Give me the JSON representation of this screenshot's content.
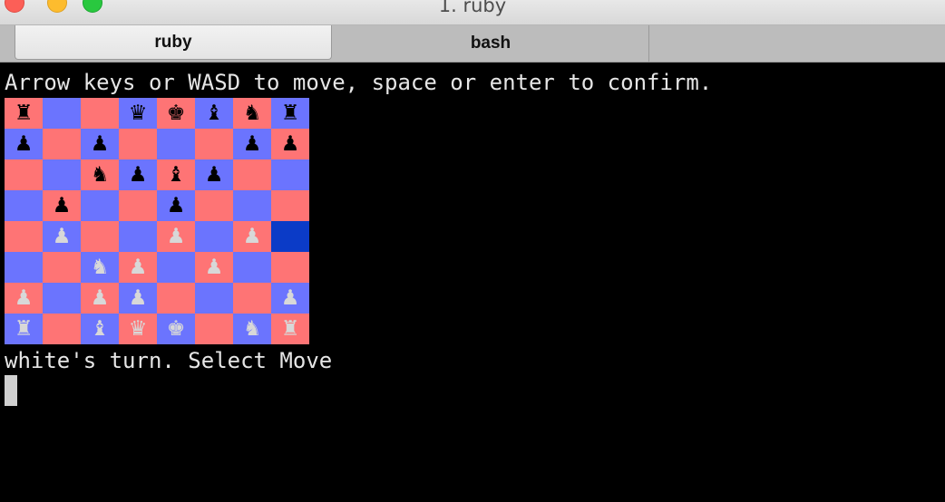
{
  "window": {
    "title": "1. ruby"
  },
  "tabs": [
    {
      "label": "ruby",
      "active": true
    },
    {
      "label": "bash",
      "active": false
    }
  ],
  "terminal": {
    "instruction": "Arrow keys or WASD to move, space or enter to confirm.",
    "status": "white's turn. Select Move"
  },
  "colors": {
    "light_square": "#fe7475",
    "dark_square": "#6b74fe",
    "cursor_square": "#0b3bc7",
    "black_piece": "#000000",
    "white_piece": "#d8d8d8"
  },
  "board": {
    "rows": [
      [
        "bR",
        "",
        "",
        "bQ",
        "bK",
        "bB",
        "bN",
        "bR"
      ],
      [
        "bP",
        "",
        "bP",
        "",
        "",
        "",
        "bP",
        "bP"
      ],
      [
        "",
        "",
        "bN",
        "bP",
        "bB",
        "bP",
        "",
        ""
      ],
      [
        "",
        "bP",
        "",
        "",
        "bP",
        "",
        "",
        ""
      ],
      [
        "",
        "wP",
        "",
        "",
        "wP",
        "",
        "wP",
        ""
      ],
      [
        "",
        "",
        "wN",
        "wP",
        "",
        "wP",
        "",
        ""
      ],
      [
        "wP",
        "",
        "wP",
        "wP",
        "",
        "",
        "",
        "wP"
      ],
      [
        "wR",
        "",
        "wB",
        "wQ",
        "wK",
        "",
        "wN",
        "wR"
      ]
    ],
    "cursor": {
      "row": 4,
      "col": 7
    }
  }
}
